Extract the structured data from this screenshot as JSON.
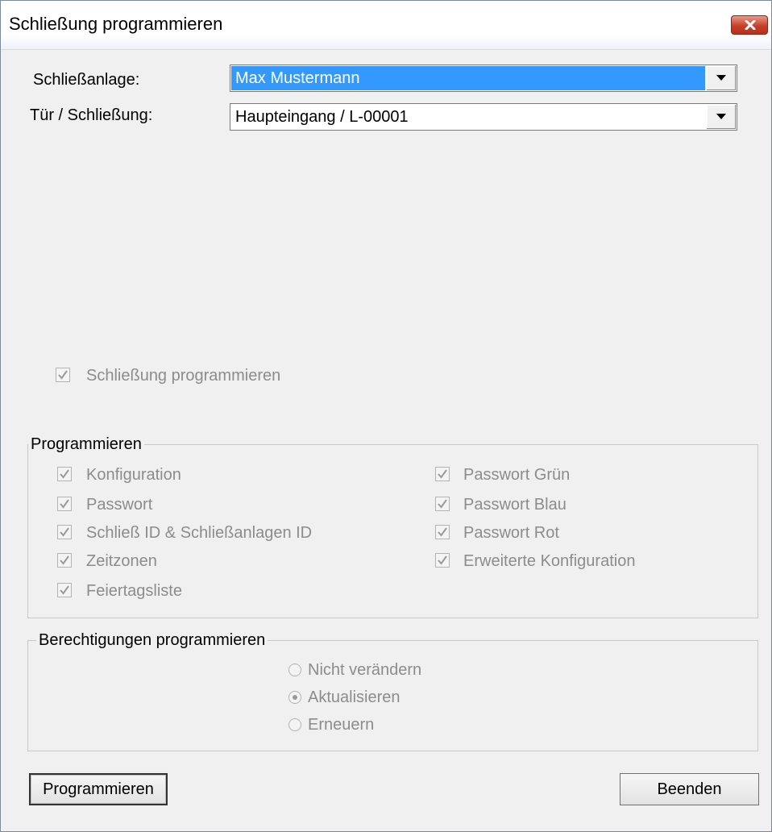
{
  "window": {
    "title": "Schließung programmieren"
  },
  "fields": {
    "schliessanlage_label": "Schließanlage:",
    "schliessanlage_value": "Max Mustermann",
    "tuer_label": "Tür / Schließung:",
    "tuer_value": "Haupteingang / L-00001"
  },
  "schliessung_programmieren": {
    "label": "Schließung programmieren",
    "checked": true,
    "enabled": false
  },
  "programmieren_group": {
    "title": "Programmieren",
    "left": [
      {
        "label": "Konfiguration",
        "checked": true
      },
      {
        "label": "Passwort",
        "checked": true
      },
      {
        "label": "Schließ ID & Schließanlagen ID",
        "checked": true
      },
      {
        "label": "Zeitzonen",
        "checked": true
      },
      {
        "label": "Feiertagsliste",
        "checked": true
      }
    ],
    "right": [
      {
        "label": "Passwort Grün",
        "checked": true
      },
      {
        "label": "Passwort Blau",
        "checked": true
      },
      {
        "label": "Passwort Rot",
        "checked": true
      },
      {
        "label": "Erweiterte Konfiguration",
        "checked": true
      }
    ]
  },
  "berechtigungen_group": {
    "title": "Berechtigungen programmieren",
    "options": [
      {
        "label": "Nicht verändern",
        "selected": false
      },
      {
        "label": "Aktualisieren",
        "selected": true
      },
      {
        "label": "Erneuern",
        "selected": false
      }
    ]
  },
  "buttons": {
    "programmieren": "Programmieren",
    "beenden": "Beenden"
  },
  "colors": {
    "selection": "#3399ff",
    "close_button": "#c7402a",
    "disabled_text": "#8c8c8c"
  }
}
